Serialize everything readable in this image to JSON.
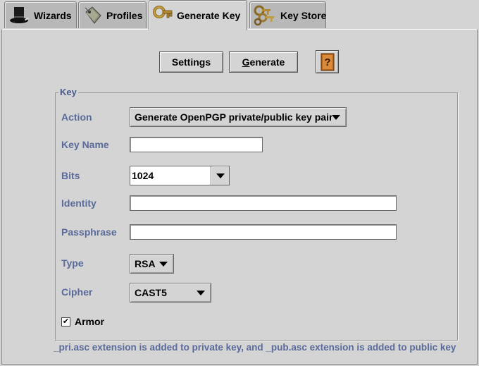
{
  "tabs": [
    {
      "label": "Wizards",
      "icon": "top-hat-icon",
      "active": false
    },
    {
      "label": "Profiles",
      "icon": "profile-tag-icon",
      "active": false
    },
    {
      "label": "Generate Key",
      "icon": "key-icon",
      "active": true
    },
    {
      "label": "Key Store",
      "icon": "keys-store-icon",
      "active": false
    }
  ],
  "toolbar": {
    "settings_label": "Settings",
    "generate_mnemonic": "G",
    "generate_rest": "enerate",
    "help_icon": "help-book-icon"
  },
  "group": {
    "title": "Key",
    "action_label": "Action",
    "action_value": "Generate OpenPGP private/public key pair",
    "keyname_label": "Key Name",
    "keyname_value": "",
    "bits_label": "Bits",
    "bits_value": "1024",
    "identity_label": "Identity",
    "identity_value": "",
    "passphrase_label": "Passphrase",
    "passphrase_value": "",
    "type_label": "Type",
    "type_value": "RSA",
    "cipher_label": "Cipher",
    "cipher_value": "CAST5",
    "armor_label": "Armor",
    "armor_checked": true,
    "armor_mark": "✔"
  },
  "footer": {
    "note": "_pri.asc extension is added to private key, and _pub.asc extension is added to public key"
  },
  "colors": {
    "background": "#d4d4d4",
    "label": "#5a6a9a",
    "tab_inactive": "#b8b8b8"
  }
}
